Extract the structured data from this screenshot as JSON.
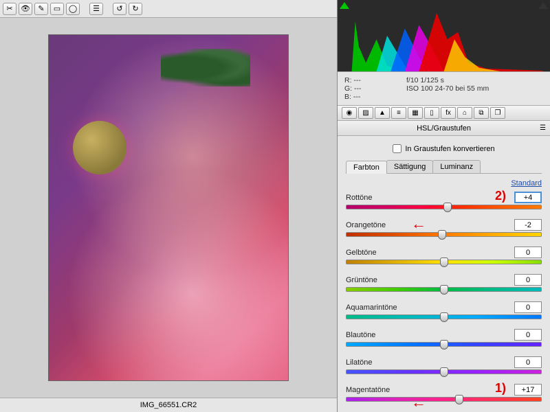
{
  "filename": "IMG_66551.CR2",
  "meta": {
    "r": "R:   ---",
    "g": "G:   ---",
    "b": "B:   ---",
    "aperture_shutter": "f/10    1/125 s",
    "iso_lens": "ISO 100    24-70 bei 55 mm"
  },
  "panel": {
    "title": "HSL/Graustufen",
    "grayscale_label": "In Graustufen konvertieren",
    "tabs": {
      "farbton": "Farbton",
      "saettigung": "Sättigung",
      "luminanz": "Luminanz"
    },
    "standard": "Standard",
    "sliders": {
      "rot": {
        "label": "Rottöne",
        "value": "+4",
        "pos": 52
      },
      "orange": {
        "label": "Orangetöne",
        "value": "-2",
        "pos": 49
      },
      "gelb": {
        "label": "Gelbtöne",
        "value": "0",
        "pos": 50
      },
      "gruen": {
        "label": "Grüntöne",
        "value": "0",
        "pos": 50
      },
      "aqua": {
        "label": "Aquamarintöne",
        "value": "0",
        "pos": 50
      },
      "blau": {
        "label": "Blautöne",
        "value": "0",
        "pos": 50
      },
      "lila": {
        "label": "Lilatöne",
        "value": "0",
        "pos": 50
      },
      "magenta": {
        "label": "Magentatöne",
        "value": "+17",
        "pos": 58
      }
    }
  },
  "annotations": {
    "one": "1)",
    "two": "2)"
  }
}
